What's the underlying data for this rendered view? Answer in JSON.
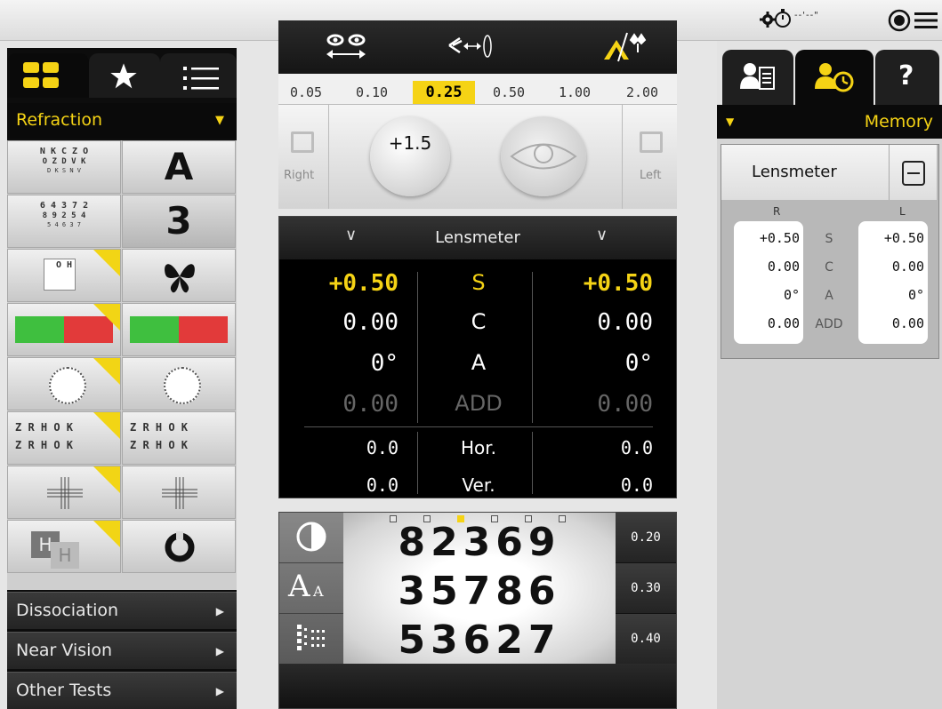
{
  "topbar": {
    "stopwatch_text": "--'--\""
  },
  "left": {
    "mode": "Refraction",
    "grid": {
      "letters_row1": "N K C Z O",
      "letters_row2": "O Z D V K",
      "letters_row3": "D K S N V",
      "digits_row1": "6 4 3 7 2",
      "digits_row2": "8 9 2 5 4",
      "digits_row3": "5 4 6 3 7",
      "big_a": "A",
      "big_3": "3",
      "oh_text": "O H",
      "zrhok": "Z R H O K"
    },
    "menus": [
      {
        "label": "Dissociation"
      },
      {
        "label": "Near Vision"
      },
      {
        "label": "Other Tests"
      }
    ]
  },
  "steps": {
    "values": [
      "0.05",
      "0.10",
      "0.25",
      "0.50",
      "1.00",
      "2.00"
    ],
    "selected": "0.25"
  },
  "eye_row": {
    "right_label": "Right",
    "left_label": "Left",
    "bubble_value": "+1.5"
  },
  "lensmeter": {
    "title": "Lensmeter",
    "right": {
      "S": "+0.50",
      "C": "0.00",
      "A": "0°",
      "ADD": "0.00",
      "Hor": "0.0",
      "Ver": "0.0"
    },
    "left": {
      "S": "+0.50",
      "C": "0.00",
      "A": "0°",
      "ADD": "0.00",
      "Hor": "0.0",
      "Ver": "0.0"
    },
    "labels": {
      "S": "S",
      "C": "C",
      "A": "A",
      "ADD": "ADD",
      "Hor": "Hor.",
      "Ver": "Ver."
    }
  },
  "acuity": {
    "lines": [
      "82369",
      "35786",
      "53627"
    ],
    "sizes": [
      "0.20",
      "0.30",
      "0.40"
    ],
    "tool_text": "A",
    "tool_text_small": "A"
  },
  "memory": {
    "header": "Memory",
    "card_title": "Lensmeter",
    "col_r": "R",
    "col_l": "L",
    "rows": [
      {
        "label": "S",
        "r": "+0.50",
        "l": "+0.50"
      },
      {
        "label": "C",
        "r": "0.00",
        "l": "0.00"
      },
      {
        "label": "A",
        "r": "0°",
        "l": "0°"
      },
      {
        "label": "ADD",
        "r": "0.00",
        "l": "0.00"
      }
    ]
  },
  "colors": {
    "accent": "#f5d315",
    "panel": "#0d0d0d"
  }
}
